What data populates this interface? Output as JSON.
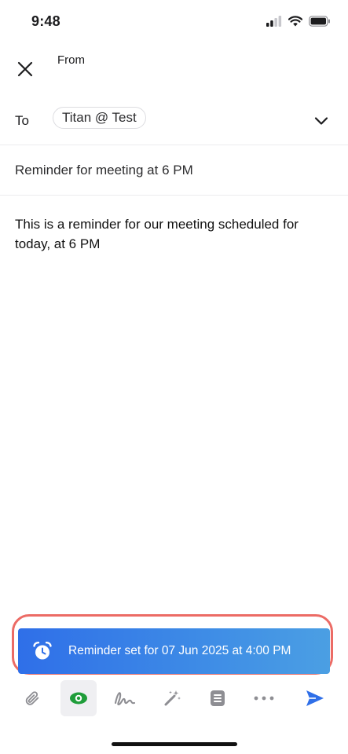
{
  "status_bar": {
    "time": "9:48",
    "icons": [
      "cellular-signal-icon",
      "wifi-icon",
      "battery-icon"
    ]
  },
  "header": {
    "close_icon": "close-icon",
    "from_label": "From"
  },
  "to_row": {
    "label": "To",
    "recipient": "Titan @ Test",
    "expand_icon": "chevron-down-icon"
  },
  "subject": "Reminder for meeting at 6 PM",
  "body": "This is a reminder for our meeting scheduled for today, at 6 PM",
  "reminder_banner": {
    "icon": "alarm-clock-icon",
    "text": "Reminder set for 07 Jun 2025 at 4:00 PM"
  },
  "toolbar": {
    "items": [
      {
        "icon": "attachment-icon",
        "active": false
      },
      {
        "icon": "eye-icon",
        "active": true
      },
      {
        "icon": "signature-icon",
        "active": false
      },
      {
        "icon": "magic-wand-icon",
        "active": false
      },
      {
        "icon": "template-icon",
        "active": false
      },
      {
        "icon": "more-icon",
        "active": false
      },
      {
        "icon": "send-icon",
        "active": false
      }
    ]
  },
  "colors": {
    "accent": "#2f6fe8",
    "highlight_outline": "#ec6b65",
    "eye_green": "#1f9d3a"
  }
}
